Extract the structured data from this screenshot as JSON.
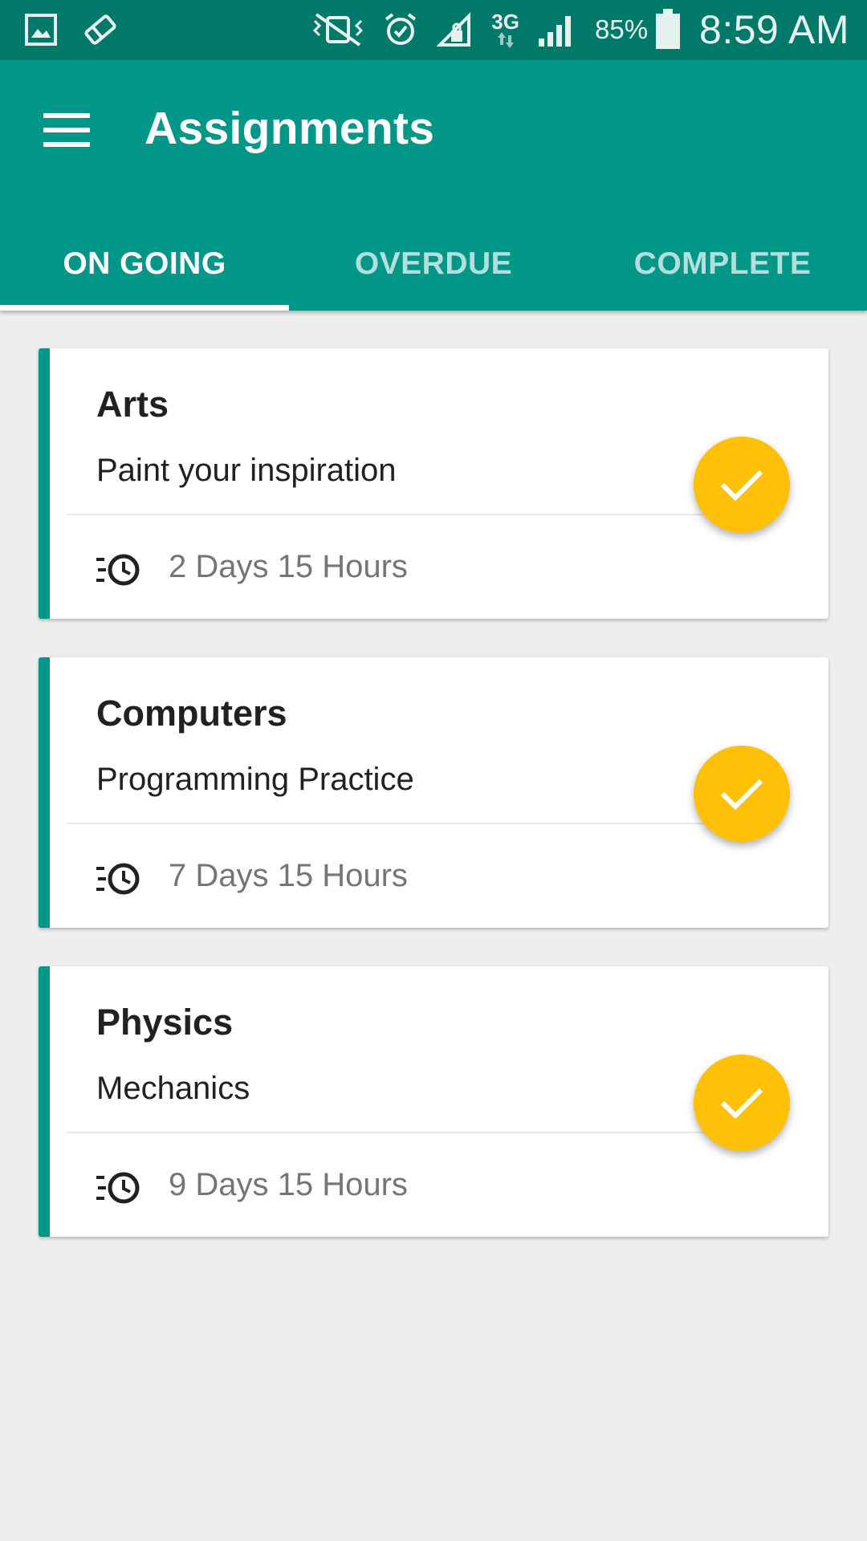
{
  "status_bar": {
    "network": "3G",
    "battery": "85%",
    "time": "8:59 AM"
  },
  "app_bar": {
    "title": "Assignments"
  },
  "tabs": [
    {
      "label": "ON GOING",
      "active": true
    },
    {
      "label": "OVERDUE",
      "active": false
    },
    {
      "label": "COMPLETE",
      "active": false
    }
  ],
  "assignments": [
    {
      "subject": "Arts",
      "title": "Paint your inspiration",
      "time_left": "2 Days 15 Hours"
    },
    {
      "subject": "Computers",
      "title": "Programming Practice",
      "time_left": "7 Days 15 Hours"
    },
    {
      "subject": "Physics",
      "title": "Mechanics",
      "time_left": "9 Days 15 Hours"
    }
  ],
  "colors": {
    "primary": "#009688",
    "primary_dark": "#00796b",
    "accent": "#ffc107",
    "background": "#eeeeee"
  },
  "icons": {
    "menu": "hamburger-icon",
    "time": "history-clock-icon",
    "complete": "check-icon"
  }
}
